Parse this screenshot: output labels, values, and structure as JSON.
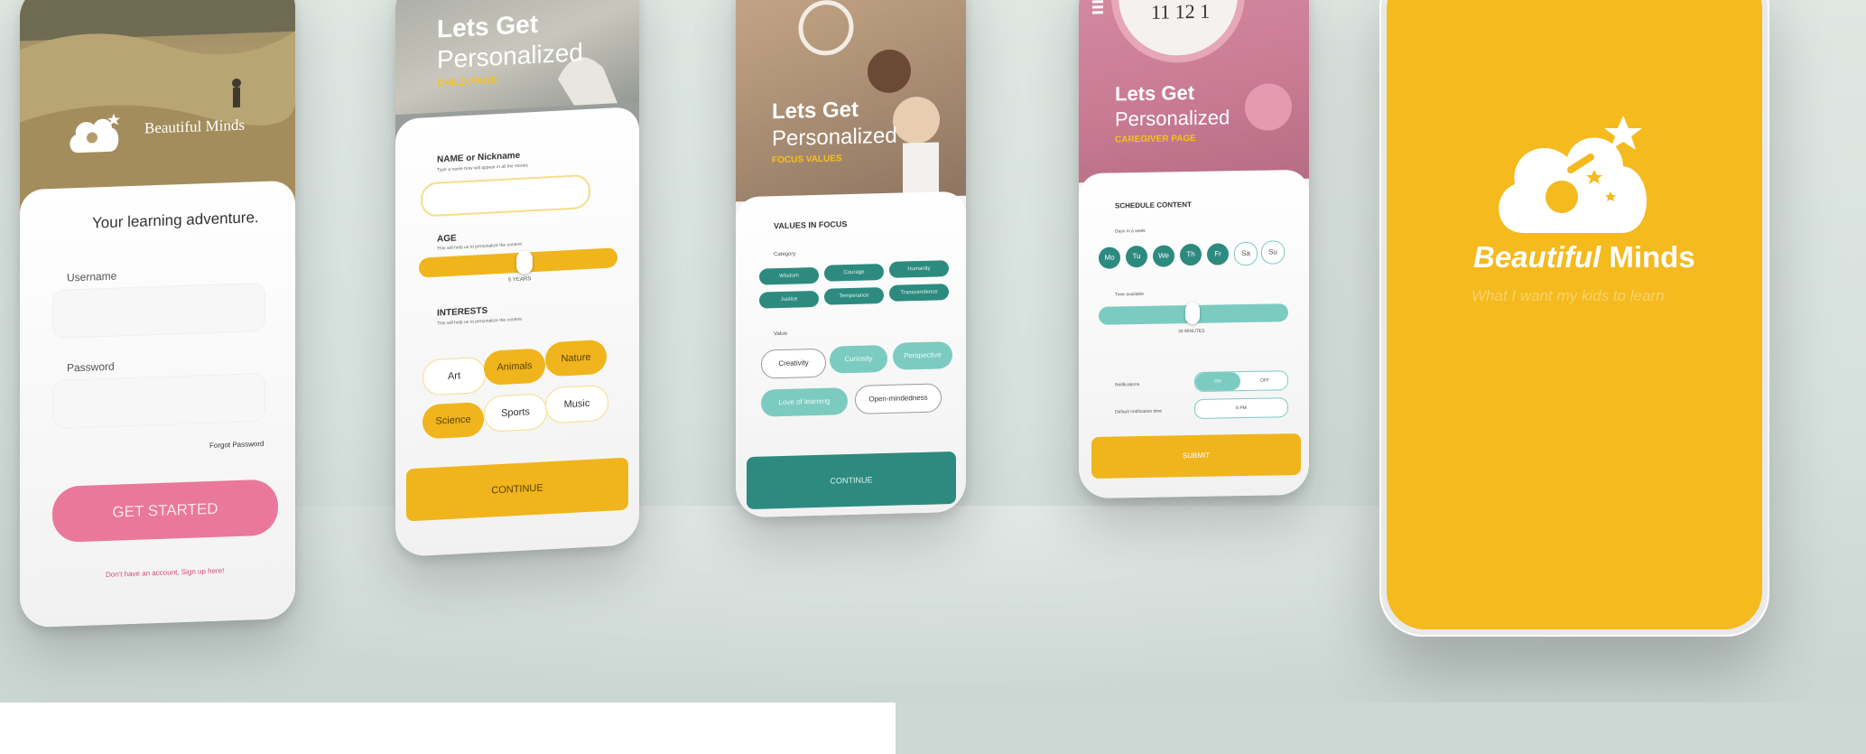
{
  "brand": {
    "name_prefix": "Beautiful",
    "name_suffix": "Minds",
    "logo_text": "Beautiful Minds",
    "tagline": "What I want my kids to learn",
    "color_yellow": "#f4ba1e",
    "color_pink": "#e9789a",
    "color_teal": "#2d8a7f"
  },
  "login": {
    "heading": "Your learning adventure.",
    "username_label": "Username",
    "password_label": "Password",
    "forgot": "Forgot Password",
    "cta": "GET STARTED",
    "signup": "Don't have an account, Sign up here!"
  },
  "child": {
    "title1": "Lets Get",
    "title2": "Personalized",
    "subtitle": "CHILD PAGE",
    "name_label": "NAME or Nickname",
    "name_help": "Type a name how will appear in all the stories",
    "age_label": "AGE",
    "age_help": "This will help us to personalize the content",
    "age_value": "5 YEARS",
    "interests_label": "INTERESTS",
    "interests_help": "This will help us to personalize the content",
    "interests": [
      {
        "label": "Art",
        "selected": false
      },
      {
        "label": "Animals",
        "selected": true
      },
      {
        "label": "Nature",
        "selected": true
      },
      {
        "label": "Science",
        "selected": true
      },
      {
        "label": "Sports",
        "selected": false
      },
      {
        "label": "Music",
        "selected": false
      }
    ],
    "cta": "CONTINUE"
  },
  "focus": {
    "title1": "Lets Get",
    "title2": "Personalized",
    "subtitle": "FOCUS VALUES",
    "section": "VALUES IN FOCUS",
    "category_label": "Category",
    "categories": [
      "Wisdom",
      "Courage",
      "Humanity",
      "Justice",
      "Temperance",
      "Transcendence"
    ],
    "value_label": "Value",
    "values": [
      {
        "label": "Creativity",
        "selected": false
      },
      {
        "label": "Curiosity",
        "selected": true
      },
      {
        "label": "Perspective",
        "selected": true
      },
      {
        "label": "Love of learning",
        "selected": true
      },
      {
        "label": "Open-mindedness",
        "selected": false
      }
    ],
    "cta": "CONTINUE"
  },
  "caregiver": {
    "title1": "Lets Get",
    "title2": "Personalized",
    "subtitle": "CAREGIVER PAGE",
    "section": "SCHEDULE CONTENT",
    "days_label": "Days in a week",
    "days": [
      {
        "label": "Mo",
        "selected": true
      },
      {
        "label": "Tu",
        "selected": true
      },
      {
        "label": "We",
        "selected": true
      },
      {
        "label": "Th",
        "selected": true
      },
      {
        "label": "Fr",
        "selected": true
      },
      {
        "label": "Sa",
        "selected": false
      },
      {
        "label": "Su",
        "selected": false
      }
    ],
    "time_label": "Time available",
    "time_value": "30 MINUTES",
    "notifications_label": "Notifications",
    "on": "ON",
    "off": "OFF",
    "default_time_label": "Default notification time",
    "default_time_value": "6 PM",
    "cta": "SUBMIT"
  }
}
